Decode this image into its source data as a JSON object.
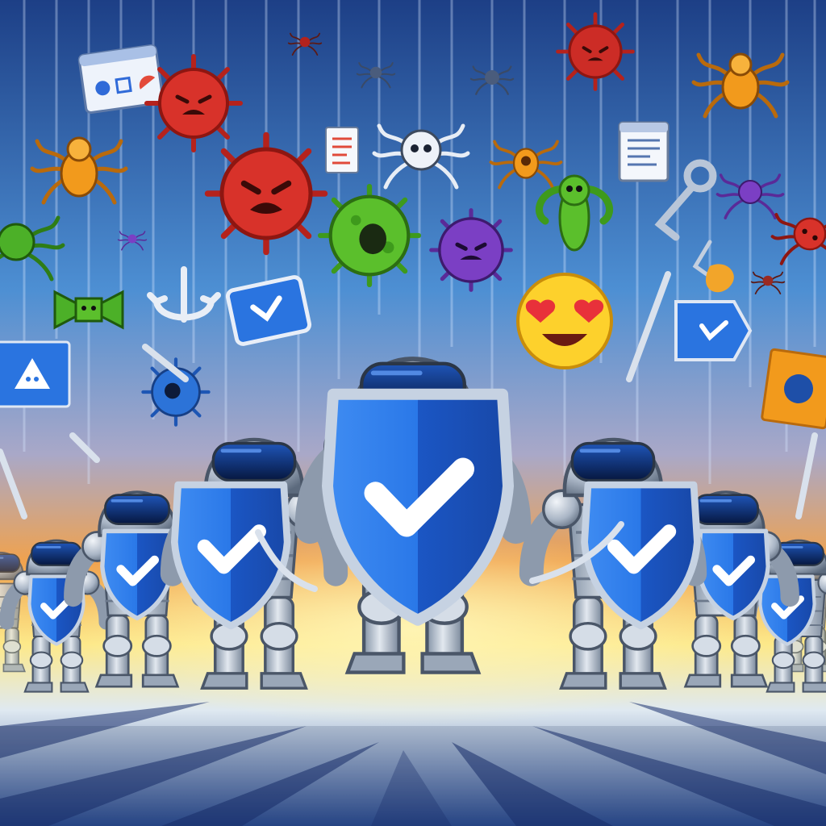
{
  "scene": {
    "colors": {
      "sky_top": "#1d3f86",
      "sky_mid": "#4d8fd3",
      "horizon_orange": "#f0a24e",
      "horizon_yellow": "#fde98a",
      "floor_light": "#dfe9f1",
      "floor_dark": "#1a2f6e",
      "shield_blue": "#1e63d6",
      "shield_blue_light": "#3f8cf2",
      "shield_rim": "#b9c6d8",
      "armor_silver": "#b7c3d1",
      "armor_dark": "#5c6a7d",
      "visor": "#0c2a6a",
      "virus_red": "#d8322a",
      "virus_green": "#5bbf2c",
      "virus_purple": "#7b3fc4",
      "bug_orange": "#f29a1c",
      "emoji_yellow": "#fdd12c",
      "emoji_heart": "#e8313a"
    },
    "icons": [
      "shield-check-icon",
      "red-virus-icon",
      "green-virus-icon",
      "purple-virus-icon",
      "blue-virus-icon",
      "orange-spider-bug-icon",
      "green-spider-bug-icon",
      "skull-spider-icon",
      "heart-eyes-emoji-icon",
      "browser-window-icon",
      "warning-sign-icon",
      "fishing-hook-icon",
      "anchor-hook-icon"
    ]
  }
}
